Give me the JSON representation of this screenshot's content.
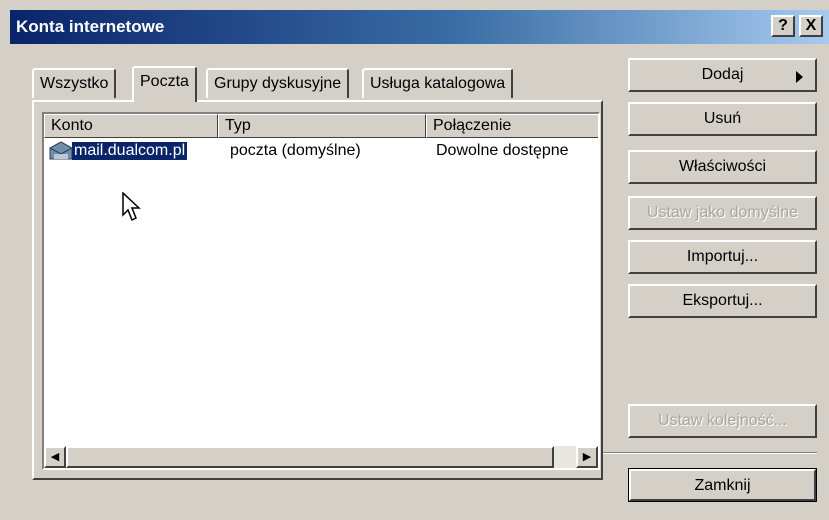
{
  "window": {
    "title": "Konta internetowe",
    "help_label": "?",
    "close_label": "X"
  },
  "tabs": [
    {
      "label": "Wszystko"
    },
    {
      "label": "Poczta",
      "active": true
    },
    {
      "label": "Grupy dyskusyjne"
    },
    {
      "label": "Usługa katalogowa"
    }
  ],
  "list": {
    "columns": [
      "Konto",
      "Typ",
      "Połączenie"
    ],
    "rows": [
      {
        "account": "mail.dualcom.pl",
        "type": "poczta (domyślne)",
        "connection": "Dowolne dostępne",
        "selected": true
      }
    ]
  },
  "buttons": {
    "add": "Dodaj",
    "remove": "Usuń",
    "properties": "Właściwości",
    "set_default": "Ustaw jako domyślne",
    "import": "Importuj...",
    "export": "Eksportuj...",
    "set_order": "Ustaw kolejność...",
    "close": "Zamknij"
  },
  "icons": {
    "account": "mail-account-icon",
    "scroll_left": "arrow-left-icon",
    "scroll_right": "arrow-right-icon",
    "submenu": "submenu-arrow-icon",
    "cursor": "mouse-pointer-icon"
  },
  "colors": {
    "title_bar": "#0a246a",
    "selection": "#0a246a",
    "face": "#d4d0c8"
  }
}
